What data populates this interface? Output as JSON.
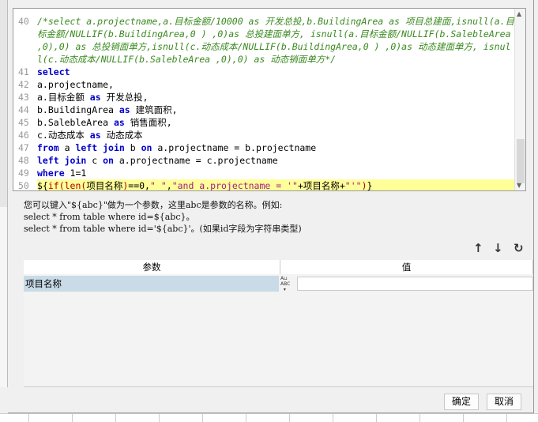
{
  "editor": {
    "lines": [
      {
        "n": "40",
        "seg": [
          {
            "c": "cm",
            "t": "/*select a.projectname,a.目标金额/10000 as 开发总投,b.BuildingArea as 项目总建面,isnull(a.目标金额/NULLIF(b.BuildingArea,0 ) ,0)as 总投建面单方, isnull(a.目标金额/NULLIF(b.SalebleArea ,0),0) as 总投销面单方,isnull(c.动态成本/NULLIF(b.BuildingArea,0 ) ,0)as 动态建面单方, isnull(c.动态成本/NULLIF(b.SalebleArea ,0),0) as 动态销面单方*/"
          }
        ]
      },
      {
        "n": "41",
        "seg": [
          {
            "c": "kw",
            "t": "select"
          }
        ]
      },
      {
        "n": "42",
        "seg": [
          {
            "c": "pl",
            "t": "a.projectname,"
          }
        ]
      },
      {
        "n": "43",
        "seg": [
          {
            "c": "pl",
            "t": "a.目标金额 "
          },
          {
            "c": "kw",
            "t": "as"
          },
          {
            "c": "pl",
            "t": " 开发总投,"
          }
        ]
      },
      {
        "n": "44",
        "seg": [
          {
            "c": "pl",
            "t": "b.BuildingArea "
          },
          {
            "c": "kw",
            "t": "as"
          },
          {
            "c": "pl",
            "t": " 建筑面积,"
          }
        ]
      },
      {
        "n": "45",
        "seg": [
          {
            "c": "pl",
            "t": "b.SalebleArea "
          },
          {
            "c": "kw",
            "t": "as"
          },
          {
            "c": "pl",
            "t": " 销售面积,"
          }
        ]
      },
      {
        "n": "46",
        "seg": [
          {
            "c": "pl",
            "t": "c.动态成本 "
          },
          {
            "c": "kw",
            "t": "as"
          },
          {
            "c": "pl",
            "t": " 动态成本"
          }
        ]
      },
      {
        "n": "47",
        "seg": [
          {
            "c": "kw",
            "t": "from"
          },
          {
            "c": "pl",
            "t": " a "
          },
          {
            "c": "kw",
            "t": "left join"
          },
          {
            "c": "pl",
            "t": " b "
          },
          {
            "c": "kw",
            "t": "on"
          },
          {
            "c": "pl",
            "t": " a.projectname = b.projectname"
          }
        ]
      },
      {
        "n": "48",
        "seg": [
          {
            "c": "kw",
            "t": "left join"
          },
          {
            "c": "pl",
            "t": " c "
          },
          {
            "c": "kw",
            "t": "on"
          },
          {
            "c": "pl",
            "t": " a.projectname = c.projectname"
          }
        ]
      },
      {
        "n": "49",
        "seg": [
          {
            "c": "kw",
            "t": "where"
          },
          {
            "c": "pl",
            "t": " 1=1"
          }
        ]
      },
      {
        "n": "50",
        "hl": true,
        "seg": [
          {
            "c": "pl",
            "t": "${"
          },
          {
            "c": "fn",
            "t": "if(len("
          },
          {
            "c": "pl",
            "t": "项目名称"
          },
          {
            "c": "fn",
            "t": ")"
          },
          {
            "c": "pl",
            "t": "==0,"
          },
          {
            "c": "str",
            "t": "\" \""
          },
          {
            "c": "pl",
            "t": ","
          },
          {
            "c": "str",
            "t": "\"and a.projectname = '\""
          },
          {
            "c": "pl",
            "t": "+项目名称+"
          },
          {
            "c": "str",
            "t": "\"'\""
          },
          {
            "c": "fn",
            "t": ")"
          },
          {
            "c": "pl",
            "t": "}"
          }
        ]
      }
    ]
  },
  "info": {
    "line1": "您可以键入\"${abc}\"做为一个参数，这里abc是参数的名称。例如:",
    "line2": "select * from table where id=${abc}。",
    "line3": "select * from table where id='${abc}'。(如果id字段为字符串类型)"
  },
  "table": {
    "headers": [
      "参数",
      "值"
    ],
    "rows": [
      {
        "name": "项目名称",
        "value": "",
        "type_icon": "ABC"
      }
    ]
  },
  "buttons": {
    "ok": "确定",
    "cancel": "取消"
  }
}
